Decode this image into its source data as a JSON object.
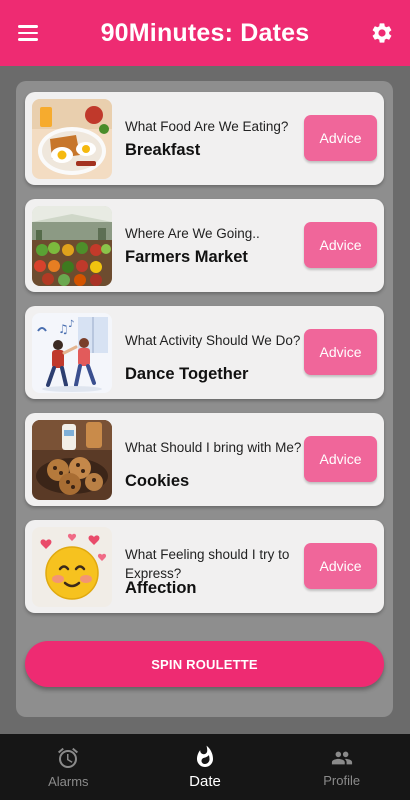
{
  "app_bar": {
    "title": "90Minutes: Dates",
    "menu_icon": "menu-icon",
    "settings_icon": "gear-icon"
  },
  "cards": [
    {
      "question": "What Food Are We Eating?",
      "answer": "Breakfast",
      "button": "Advice",
      "image": "breakfast-image"
    },
    {
      "question": "Where Are We Going..",
      "answer": "Farmers Market",
      "button": "Advice",
      "image": "farmers-market-image"
    },
    {
      "question": "What Activity Should We Do?",
      "answer": "Dance Together",
      "button": "Advice",
      "image": "dance-image"
    },
    {
      "question": "What Should I bring with Me?",
      "answer": "Cookies",
      "button": "Advice",
      "image": "cookies-image"
    },
    {
      "question": "What Feeling should I try to Express?",
      "answer": "Affection",
      "button": "Advice",
      "image": "affection-emoji-image"
    }
  ],
  "spin_button": "SPIN ROULETTE",
  "bottom_nav": {
    "items": [
      {
        "label": "Alarms",
        "icon": "alarm-clock-icon",
        "active": false
      },
      {
        "label": "Date",
        "icon": "flame-icon",
        "active": true
      },
      {
        "label": "Profile",
        "icon": "people-icon",
        "active": false
      }
    ]
  },
  "colors": {
    "accent": "#ee2b72",
    "advice_button": "#f0669a",
    "panel": "#8e8e8e",
    "card": "#f1f0f0",
    "nav_background": "#161616"
  }
}
